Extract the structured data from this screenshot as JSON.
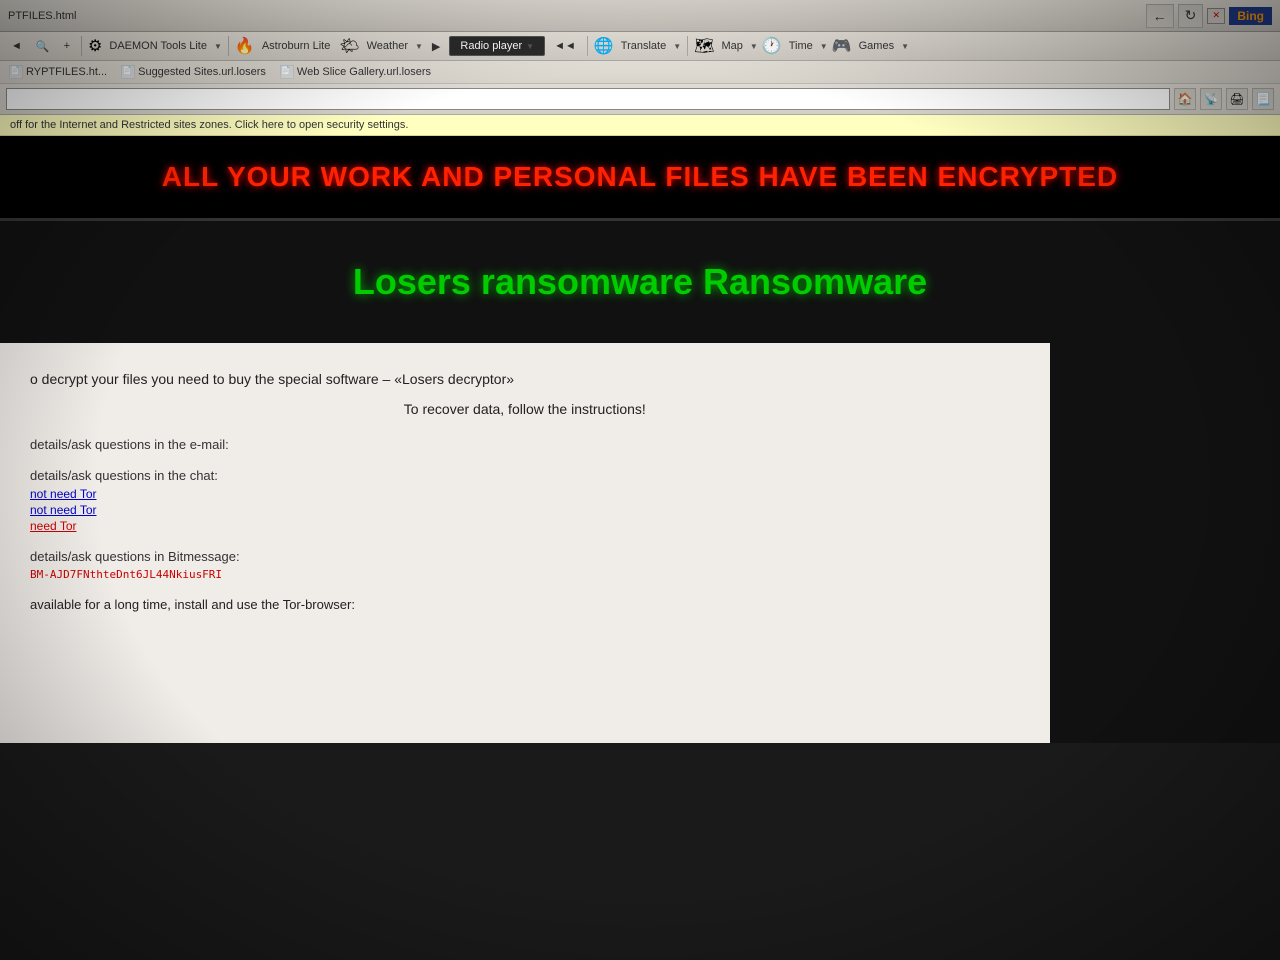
{
  "browser": {
    "tab_title": "PTFILES.html",
    "bing_label": "Bing",
    "close_btn": "✕",
    "refresh_btn": "↻",
    "nav_back": "←",
    "nav_forward": "→"
  },
  "toolbar": {
    "daemon_tools": "DAEMON Tools Lite",
    "astroburn": "Astroburn Lite",
    "weather": "Weather",
    "radio_player": "Radio player",
    "translate": "Translate",
    "map": "Map",
    "time": "Time",
    "games": "Games"
  },
  "favorites": {
    "item1": "RYPTFILES.ht...",
    "item2": "Suggested Sites.url.losers",
    "item3": "Web Slice Gallery.url.losers"
  },
  "security_bar": {
    "text": "off for the Internet and Restricted sites zones.  Click here to open security settings."
  },
  "ransomware": {
    "header": "ALL YOUR WORK AND PERSONAL FILES HAVE BEEN ENCRYPTED",
    "title": "Losers ransomware Ransomware",
    "decrypt_text": "o decrypt your files you need to buy the special software – «Losers decryptor»",
    "recover_text": "To recover data, follow the instructions!",
    "email_label": "details/ask questions in the e-mail:",
    "chat_label": "details/ask questions in the chat:",
    "chat_link1": "not need Tor",
    "chat_link2": "not need Tor",
    "chat_link3": "need Tor",
    "bitmessage_label": "details/ask questions in Bitmessage:",
    "bitmessage_addr": "BM-AJD7FNthteDnt6JL44NkiusFRI",
    "tor_text": "available for a long time, install and use the Tor-browser:"
  }
}
